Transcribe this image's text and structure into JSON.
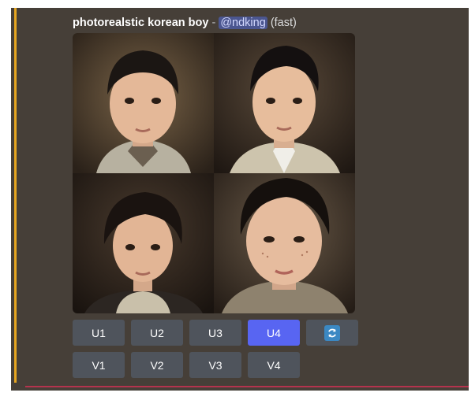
{
  "message": {
    "prompt": "photorealstic korean boy",
    "separator": " - ",
    "mention": "@ndking",
    "mode": "(fast)"
  },
  "images": [
    {
      "name": "image-1"
    },
    {
      "name": "image-2"
    },
    {
      "name": "image-3"
    },
    {
      "name": "image-4"
    }
  ],
  "buttons": {
    "upscale": [
      "U1",
      "U2",
      "U3",
      "U4"
    ],
    "variation": [
      "V1",
      "V2",
      "V3",
      "V4"
    ],
    "active": "U4",
    "reroll_icon": "refresh-icon"
  },
  "colors": {
    "accent": "#e7a621",
    "active_button": "#5865f2",
    "button": "#4f545c"
  }
}
